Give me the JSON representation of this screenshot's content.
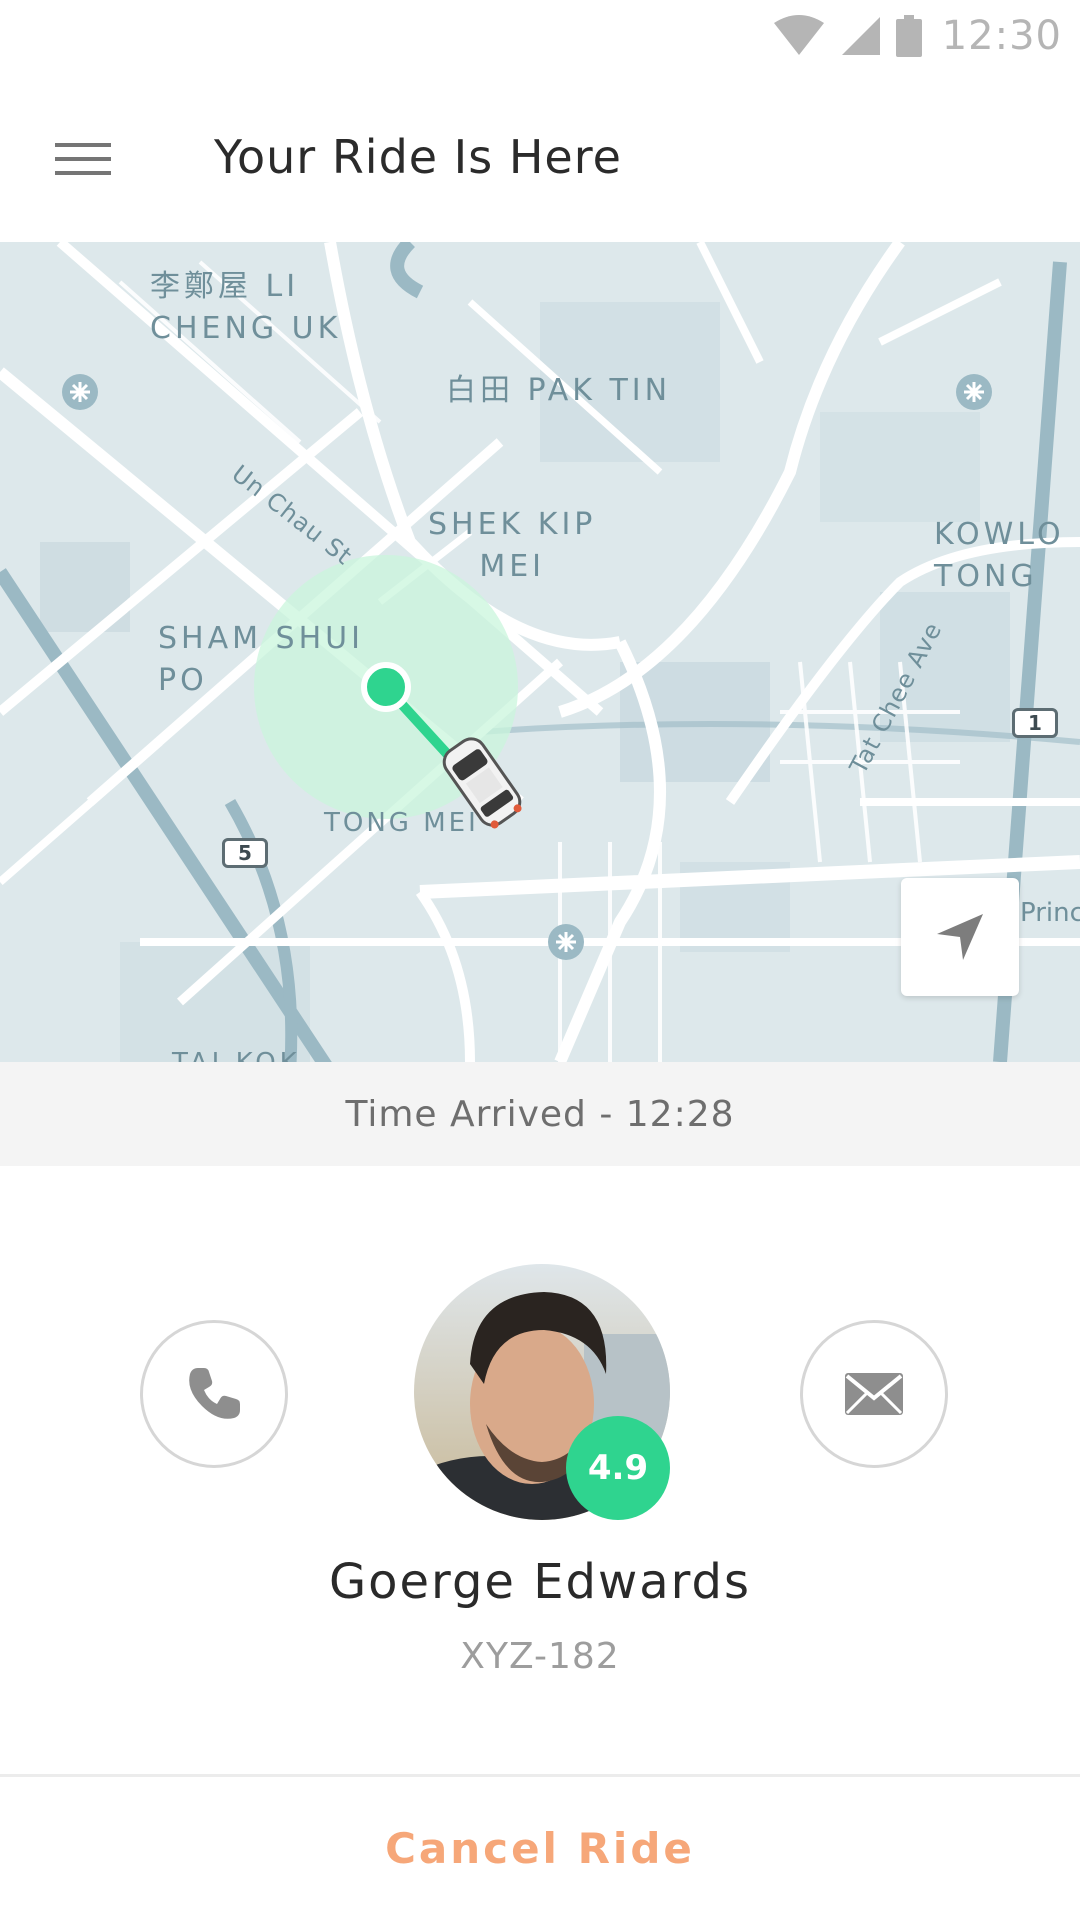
{
  "status_bar": {
    "time": "12:30",
    "icons": [
      "wifi-icon",
      "signal-icon",
      "battery-icon"
    ]
  },
  "app_bar": {
    "menu_icon": "menu-icon",
    "title": "Your Ride Is Here"
  },
  "map": {
    "labels": {
      "li_cheng_uk": "李鄭屋 LI\nCHENG UK",
      "pak_tin": "白田 PAK TIN",
      "shek_kip_mei": "SHEK KIP\nMEI",
      "sham_shui_po": "SHAM SHUI\nPO",
      "tong_mei": "TONG MEI",
      "kowloon_tong": "KOWLO\nTONG",
      "un_chau_st": "Un Chau St",
      "tat_chee_ave": "Tat Chee Ave",
      "tai_kok": "TAI KOK",
      "princ": "Princ",
      "route_5": "5",
      "route_1": "1"
    },
    "locate_icon": "navigation-arrow-icon",
    "colors": {
      "pickup": "#2fd48f",
      "pickup_radius": "#c9f5dc",
      "roads": "#ffffff",
      "water_roads": "#9bb9c4"
    }
  },
  "arrival": {
    "text": "Time Arrived - 12:28"
  },
  "driver": {
    "name": "Goerge Edwards",
    "plate": "XYZ-182",
    "rating": "4.9",
    "call_icon": "phone-icon",
    "message_icon": "envelope-icon"
  },
  "actions": {
    "cancel_label": "Cancel Ride"
  },
  "colors": {
    "accent_green": "#2fd48f",
    "cancel_orange": "#f6a779"
  }
}
